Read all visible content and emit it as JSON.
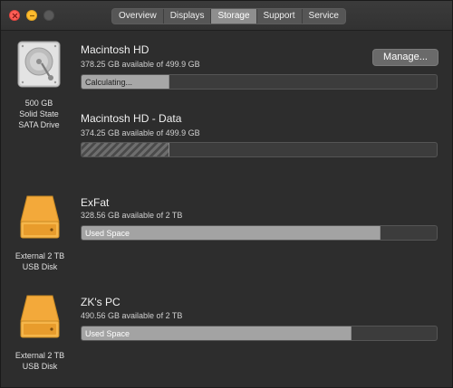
{
  "window": {
    "tabs": [
      {
        "label": "Overview",
        "active": false
      },
      {
        "label": "Displays",
        "active": false
      },
      {
        "label": "Storage",
        "active": true
      },
      {
        "label": "Support",
        "active": false
      },
      {
        "label": "Service",
        "active": false
      }
    ]
  },
  "manage_button": "Manage...",
  "disks": [
    {
      "icon": "internal-hdd-icon",
      "label": [
        "500 GB",
        "Solid State",
        "SATA Drive"
      ],
      "volumes": [
        {
          "name": "Macintosh HD",
          "available": "378.25 GB available of 499.9 GB",
          "bar_text": "Calculating...",
          "fill_fraction": 0.24
        },
        {
          "name": "Macintosh HD - Data",
          "available": "374.25 GB available of 499.9 GB",
          "bar_text": "",
          "fill_fraction": 0.24
        }
      ]
    },
    {
      "icon": "external-drive-icon",
      "label": [
        "External 2 TB",
        "USB Disk"
      ],
      "volumes": [
        {
          "name": "ExFat",
          "available": "328.56 GB available of 2 TB",
          "bar_text": "Used Space",
          "fill_fraction": 0.836
        }
      ]
    },
    {
      "icon": "external-drive-icon",
      "label": [
        "External 2 TB",
        "USB Disk"
      ],
      "volumes": [
        {
          "name": "ZK's PC",
          "available": "490.56 GB available of 2 TB",
          "bar_text": "Used Space",
          "fill_fraction": 0.755
        }
      ]
    }
  ],
  "colors": {
    "drive_orange": "#f3a93a",
    "bar_fill": "#a3a3a3",
    "bar_track": "#3c3c3c"
  }
}
